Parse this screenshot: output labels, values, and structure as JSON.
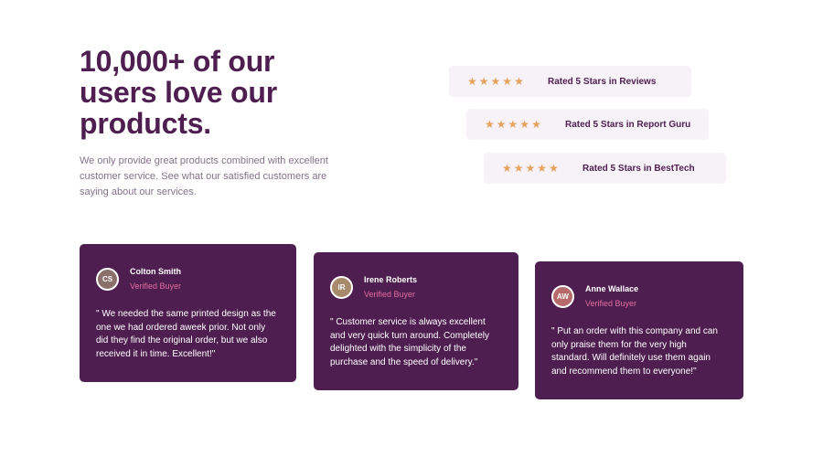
{
  "hero": {
    "heading": "10,000+ of our users love our products.",
    "intro": "We only provide great products combined with excellent customer service. See what our satisfied customers are saying about our services."
  },
  "ratings": [
    {
      "label": "Rated 5 Stars in Reviews",
      "stars": 5
    },
    {
      "label": "Rated 5 Stars in Report Guru",
      "stars": 5
    },
    {
      "label": "Rated 5 Stars in BestTech",
      "stars": 5
    }
  ],
  "star_glyph": "★",
  "testimonials": [
    {
      "name": "Colton Smith",
      "role": "Verified Buyer",
      "initials": "CS",
      "avatar_color": "#8a6f6a",
      "quote": "\" We needed the same printed design as the one we had ordered aweek prior. Not only did they find the original order, but we also received it in time. Excellent!\""
    },
    {
      "name": "Irene Roberts",
      "role": "Verified Buyer",
      "initials": "IR",
      "avatar_color": "#a88a6b",
      "quote": "\" Customer service is always excellent and very quick turn around. Completely delighted with the simplicity of the purchase and the speed of delivery.\""
    },
    {
      "name": "Anne Wallace",
      "role": "Verified Buyer",
      "initials": "AW",
      "avatar_color": "#b56b6b",
      "quote": "\" Put an order with this company and can only praise them for the very high standard. Will definitely use them again and recommend them to everyone!\""
    }
  ],
  "colors": {
    "primary": "#4f1e50",
    "accent": "#e26d9f",
    "star": "#e4a25c",
    "rating_bg": "#f7f1f8",
    "muted_text": "#84718a"
  }
}
